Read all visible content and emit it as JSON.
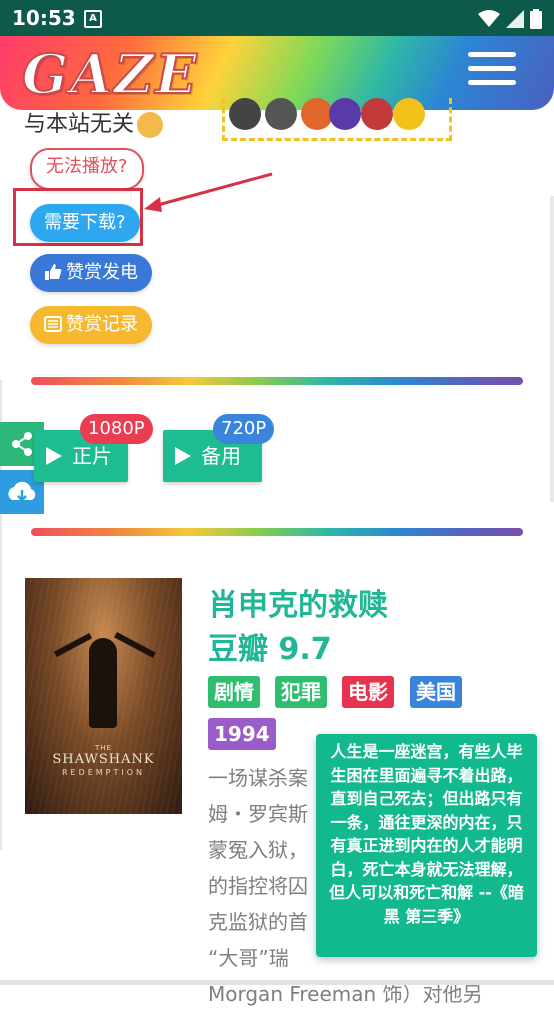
{
  "status_bar": {
    "time": "10:53",
    "notification_icon": "A"
  },
  "header": {
    "logo": "GAZE",
    "menu_icon": "hamburger-menu-icon"
  },
  "disclaimer": "与本站无关",
  "buttons": {
    "cant_play": "无法播放?",
    "need_download": "需要下载?",
    "like_donate": "赞赏发电",
    "donate_record": "赞赏记录"
  },
  "play": {
    "main_label": "正片",
    "main_badge": "1080P",
    "alt_label": "备用",
    "alt_badge": "720P"
  },
  "movie": {
    "title": "肖申克的救赎",
    "rating": "豆瓣 9.7",
    "poster_text": {
      "the": "THE",
      "title": "SHAWSHANK",
      "subtitle": "REDEMPTION"
    },
    "tags": [
      {
        "label": "剧情",
        "color": "#2fbd6f"
      },
      {
        "label": "犯罪",
        "color": "#2fbd6f"
      },
      {
        "label": "电影",
        "color": "#e8334f"
      },
      {
        "label": "美国",
        "color": "#3a84dc"
      },
      {
        "label": "1994",
        "color": "#9a5cc9"
      }
    ],
    "description_lines": [
      "一场谋杀案",
      "姆・罗宾斯",
      "蒙冤入狱，",
      "的指控将囚",
      "克监狱的首",
      "“大哥”瑞",
      "Morgan Freeman 饰）对他另"
    ]
  },
  "tooltip_quote": "人生是一座迷宫，有些人毕生困在里面遍寻不着出路，直到自己死去；但出路只有一条，通往更深的内在，只有真正进到内在的人才能明白，死亡本身就无法理解，但人可以和死亡和解 --《暗黑 第三季》",
  "colors": {
    "status_bar": "#0e5a4a",
    "accent_green": "#20b797",
    "download_blue": "#2da8f0",
    "highlight_red": "#d63245"
  }
}
